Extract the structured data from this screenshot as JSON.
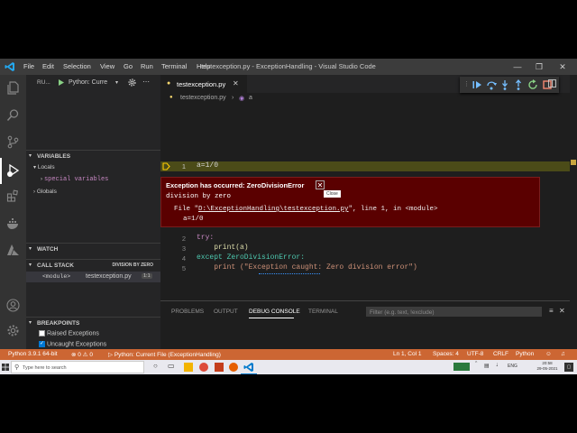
{
  "window": {
    "title": "testexception.py - ExceptionHandling - Visual Studio Code",
    "menu": [
      "File",
      "Edit",
      "Selection",
      "View",
      "Go",
      "Run",
      "Terminal",
      "Help"
    ]
  },
  "sidebar": {
    "header": "RU...",
    "run_config": "Python: Curre",
    "variables": {
      "title": "VARIABLES",
      "locals": "Locals",
      "special": "special variables",
      "globals": "Globals"
    },
    "watch_title": "WATCH",
    "callstack": {
      "title": "CALL STACK",
      "reason": "DIVISION BY ZERO",
      "frame_name": "<module>",
      "frame_file": "testexception.py",
      "frame_pos": "1:1"
    },
    "breakpoints": {
      "title": "BREAKPOINTS",
      "items": [
        {
          "label": "Raised Exceptions",
          "checked": false
        },
        {
          "label": "Uncaught Exceptions",
          "checked": true
        }
      ]
    }
  },
  "editor": {
    "tab_label": "testexception.py",
    "breadcrumb_file": "testexception.py",
    "breadcrumb_symbol": "a",
    "lines": [
      {
        "no": "1",
        "text": "a=1/0"
      },
      {
        "no": "2",
        "text": "try:"
      },
      {
        "no": "3",
        "text": "    print(a)"
      },
      {
        "no": "4",
        "text": "except ZeroDivisionError:"
      },
      {
        "no": "5",
        "text": "    print (\"Exception caught: Zero division error\")"
      }
    ],
    "exception": {
      "title": "Exception has occurred: ZeroDivisionError",
      "message": "division by zero",
      "trace_prefix": "File \"",
      "trace_link": "D:\\ExceptionHandling\\testexception.py",
      "trace_suffix": "\", line 1, in <module>",
      "trace_code": "a=1/0",
      "close_tooltip": "Close"
    }
  },
  "panel": {
    "tabs": [
      "PROBLEMS",
      "OUTPUT",
      "DEBUG CONSOLE",
      "TERMINAL"
    ],
    "active_tab": "DEBUG CONSOLE",
    "filter_placeholder": "Filter (e.g. text, !exclude)",
    "prompt": ">"
  },
  "statusbar": {
    "interpreter": "Python 3.9.1 64-bit",
    "errors": "0",
    "warnings": "0",
    "debug_config": "Python: Current File (ExceptionHandling)",
    "position": "Ln 1, Col 1",
    "spaces": "Spaces: 4",
    "encoding": "UTF-8",
    "eol": "CRLF",
    "language": "Python"
  },
  "taskbar": {
    "search_placeholder": "Type here to search",
    "lang": "ENG",
    "time": "20:58",
    "date": "29-05-2021"
  },
  "colors": {
    "statusbar": "#cc6633",
    "exception_bg": "#5a0000",
    "accent": "#007acc"
  }
}
